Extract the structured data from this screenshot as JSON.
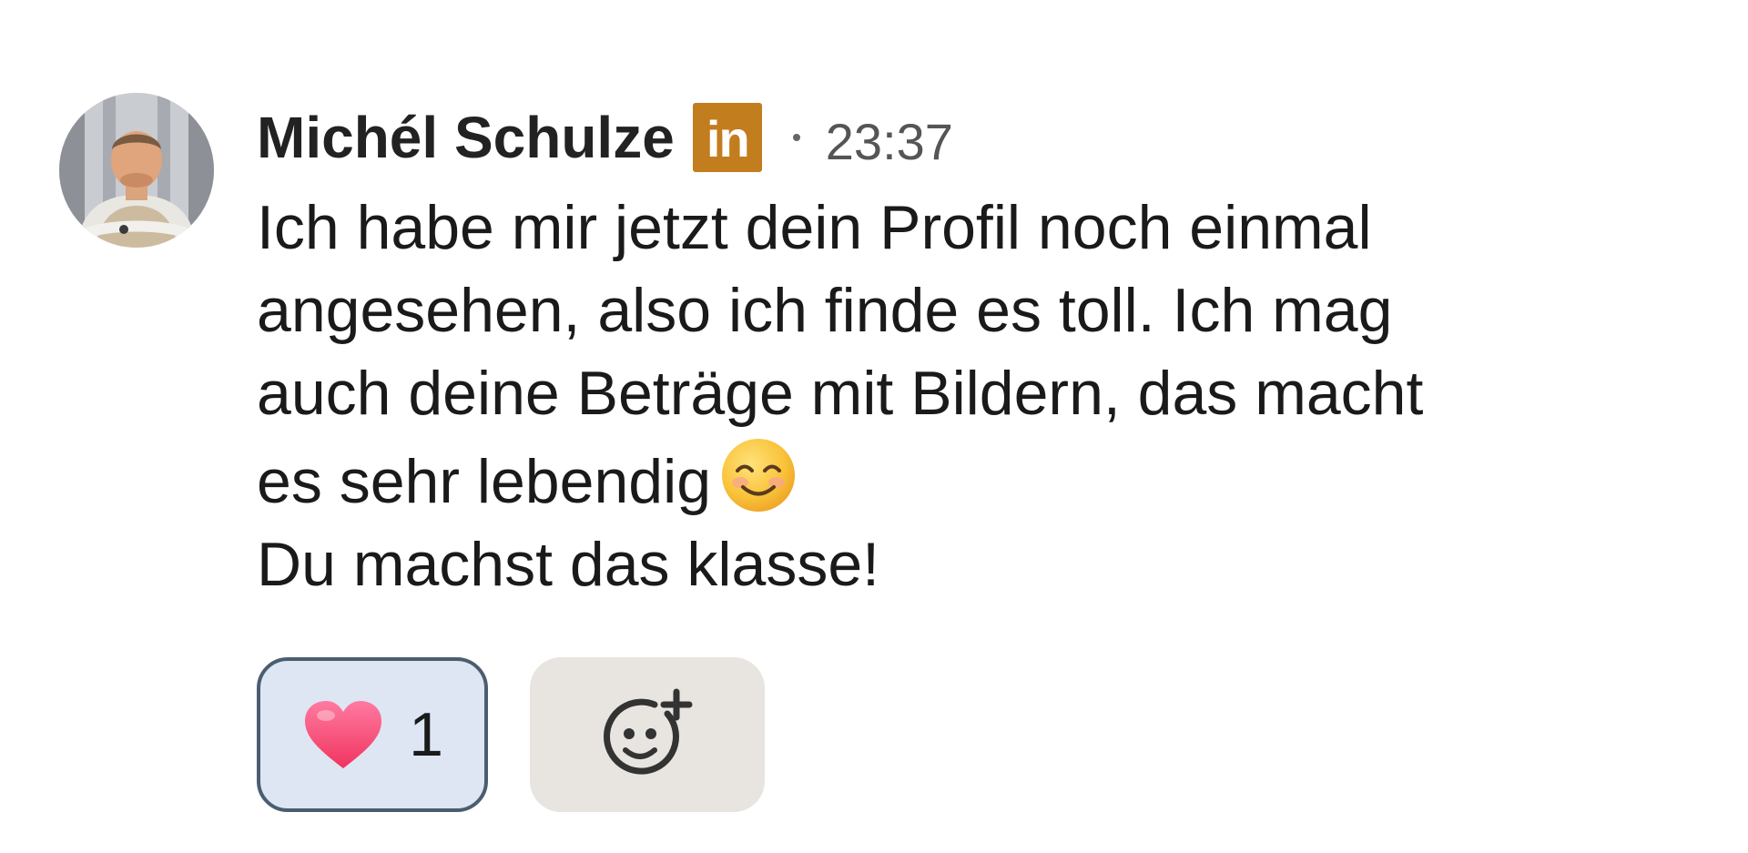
{
  "message": {
    "author_name": "Michél Schulze",
    "badge": {
      "label": "in",
      "icon": "linkedin-icon",
      "color": "#c27d1e"
    },
    "separator": "·",
    "time": "23:37",
    "avatar": {
      "icon": "profile-photo"
    },
    "body": {
      "lines": [
        "Ich habe mir jetzt dein Profil noch einmal",
        "angesehen, also ich finde es toll. Ich mag",
        "auch deine Beträge mit Bildern, das macht",
        "es sehr lebendig"
      ],
      "emoji": "smiling-face-with-smiling-eyes-icon",
      "last_line": "Du machst das klasse!"
    }
  },
  "reactions": {
    "items": [
      {
        "icon": "red-heart-icon",
        "count": "1",
        "selected": true
      }
    ],
    "add_reaction": {
      "icon": "add-reaction-icon"
    }
  },
  "colors": {
    "text": "#1a1a1a",
    "meta": "#555555",
    "reaction_bg": "#dde6f2",
    "reaction_border": "#4b5d70",
    "add_reaction_bg": "#e8e5e0"
  }
}
